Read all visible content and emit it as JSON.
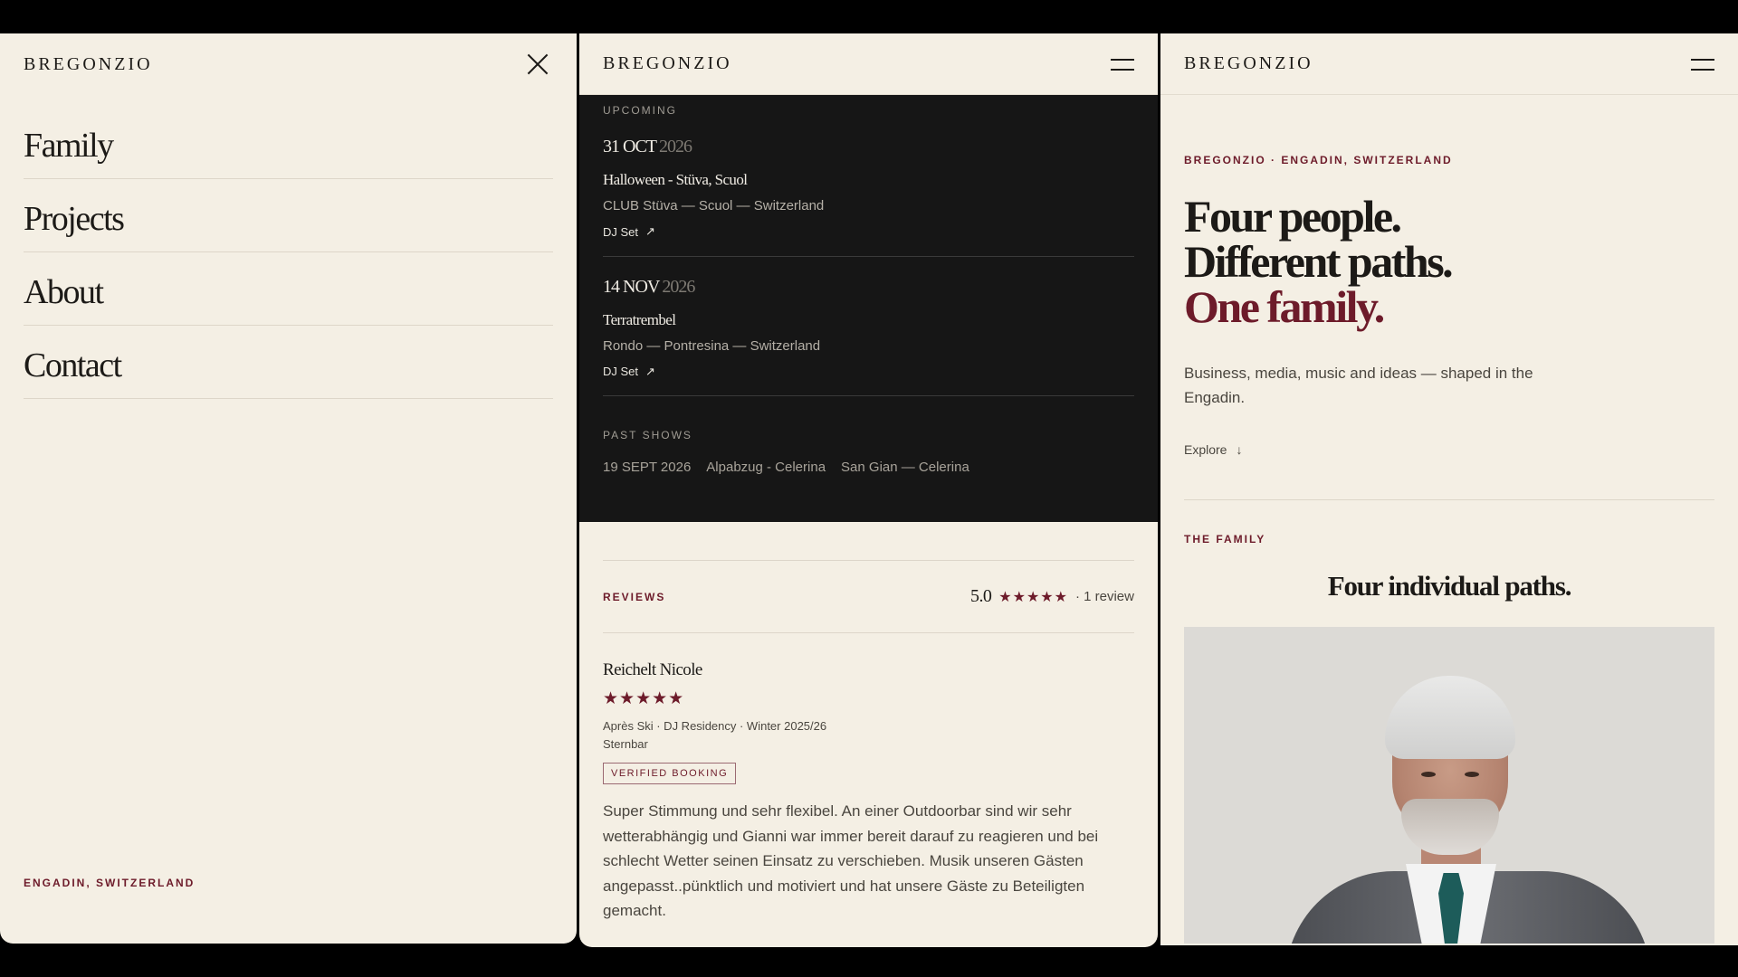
{
  "brand": "BREGONZIO",
  "menu": {
    "items": [
      "Family",
      "Projects",
      "About",
      "Contact"
    ],
    "footer": "ENGADIN, SWITZERLAND"
  },
  "shows": {
    "upcoming_label": "UPCOMING",
    "events": [
      {
        "day_month": "31 OCT",
        "year": "2026",
        "title": "Halloween - Stüva, Scuol",
        "venue": "CLUB Stüva — Scuol — Switzerland",
        "link": "DJ Set"
      },
      {
        "day_month": "14 NOV",
        "year": "2026",
        "title": "Terratrembel",
        "venue": "Rondo — Pontresina — Switzerland",
        "link": "DJ Set"
      }
    ],
    "past_label": "PAST SHOWS",
    "past": [
      "19 SEPT 2026",
      "Alpabzug - Celerina",
      "San Gian — Celerina"
    ]
  },
  "reviews": {
    "label": "REVIEWS",
    "rating": "5.0",
    "stars": 5,
    "count": "· 1 review",
    "items": [
      {
        "name": "Reichelt Nicole",
        "stars": 5,
        "meta1": "Après Ski · DJ Residency · Winter 2025/26",
        "meta2": "Sternbar",
        "badge": "VERIFIED BOOKING",
        "text": "Super Stimmung und sehr flexibel. An einer Outdoorbar sind wir sehr wetterabhängig und Gianni war immer bereit darauf zu reagieren und bei schlecht Wetter seinen Einsatz zu verschieben. Musik unseren Gästen angepasst..pünktlich und motiviert und hat unsere Gäste zu Beteiligten gemacht."
      }
    ]
  },
  "hero": {
    "eyebrow": "BREGONZIO · ENGADIN, SWITZERLAND",
    "title_lines": [
      "Four people.",
      "Different paths.",
      "One family."
    ],
    "subtitle": "Business, media, music and ideas — shaped in the Engadin.",
    "explore": "Explore"
  },
  "family": {
    "eyebrow": "THE FAMILY",
    "title": "Four individual paths."
  },
  "colors": {
    "background": "#f4efe4",
    "accent": "#6d1b2a",
    "dark": "#161616"
  },
  "icons": {
    "close": "close-icon",
    "menu": "hamburger-icon",
    "external": "arrow-up-right-icon",
    "down": "arrow-down-icon",
    "star": "star-icon"
  }
}
